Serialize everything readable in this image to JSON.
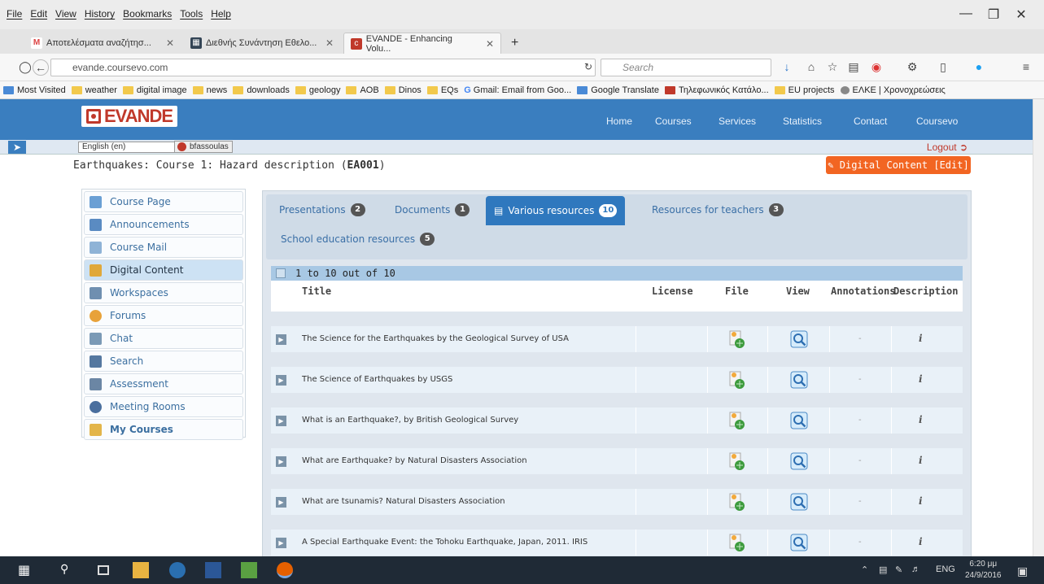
{
  "menubar": {
    "items": [
      "File",
      "Edit",
      "View",
      "History",
      "Bookmarks",
      "Tools",
      "Help"
    ]
  },
  "tabs": [
    {
      "label": "Αποτελέσματα αναζήτησ...",
      "icon": "gmail-icon"
    },
    {
      "label": "Διεθνής Συνάντηση Εθελο...",
      "icon": "page-icon"
    },
    {
      "label": "EVANDE - Enhancing Volu...",
      "icon": "evande-icon"
    }
  ],
  "nav": {
    "url": "evande.coursevo.com",
    "search_placeholder": "Search"
  },
  "bookmarks": [
    "Most Visited",
    "weather",
    "digital image",
    "news",
    "downloads",
    "geology",
    "AOB",
    "Dinos",
    "EQs",
    "Gmail: Email from Goo...",
    "Google Translate",
    "Τηλεφωνικός Κατάλο...",
    "EU projects",
    "ΕΛΚΕ | Χρονοχρεώσεις"
  ],
  "site": {
    "logo_text": "EVANDE",
    "nav": [
      "Home",
      "Courses",
      "Services",
      "Statistics",
      "Contact",
      "Coursevo"
    ],
    "language": "English (en)",
    "user": "bfassoulas",
    "logout": "Logout",
    "course_title_prefix": "Earthquakes: Course 1: Hazard description (",
    "course_code": "EA001",
    "course_title_suffix": ")",
    "edit_button": "Digital Content [Edit]"
  },
  "sidebar": {
    "items": [
      {
        "label": "Course Page",
        "color": "#6a9fd4"
      },
      {
        "label": "Announcements",
        "color": "#5a8bc2"
      },
      {
        "label": "Course Mail",
        "color": "#8fb3d6"
      },
      {
        "label": "Digital Content",
        "color": "#e0a83a"
      },
      {
        "label": "Workspaces",
        "color": "#6f8fb0"
      },
      {
        "label": "Forums",
        "color": "#e8a23a"
      },
      {
        "label": "Chat",
        "color": "#7b9ab6"
      },
      {
        "label": "Search",
        "color": "#5578a0"
      },
      {
        "label": "Assessment",
        "color": "#6b86a4"
      },
      {
        "label": "Meeting Rooms",
        "color": "#4a6f9e"
      },
      {
        "label": "My Courses",
        "color": "#e3b54a"
      }
    ]
  },
  "resource_tabs": [
    {
      "label": "Presentations",
      "count": "2"
    },
    {
      "label": "Documents",
      "count": "1"
    },
    {
      "label": "Various resources",
      "count": "10"
    },
    {
      "label": "Resources for teachers",
      "count": "3"
    },
    {
      "label": "School education resources",
      "count": "5"
    }
  ],
  "table": {
    "summary": "1 to 10 out of 10",
    "columns": [
      "Title",
      "License",
      "File",
      "View",
      "Annotations",
      "Description"
    ],
    "rows": [
      {
        "title": "The Science for the Earthquakes by the Geological Survey of USA",
        "annotations": "-",
        "description": "i"
      },
      {
        "title": "The Science of Earthquakes by USGS",
        "annotations": "-",
        "description": "i"
      },
      {
        "title": "What is an Earthquake?, by British Geological Survey",
        "annotations": "-",
        "description": "i"
      },
      {
        "title": "What are Earthquake? by Natural Disasters Association",
        "annotations": "-",
        "description": "i"
      },
      {
        "title": "What are tsunamis? Natural Disasters Association",
        "annotations": "-",
        "description": "i"
      },
      {
        "title": "A Special Earthquake Event: the Tohoku Earthquake, Japan, 2011. IRIS",
        "annotations": "-",
        "description": "i"
      }
    ]
  },
  "taskbar": {
    "time": "6:20 μμ",
    "date": "24/9/2016",
    "lang": "ENG"
  }
}
